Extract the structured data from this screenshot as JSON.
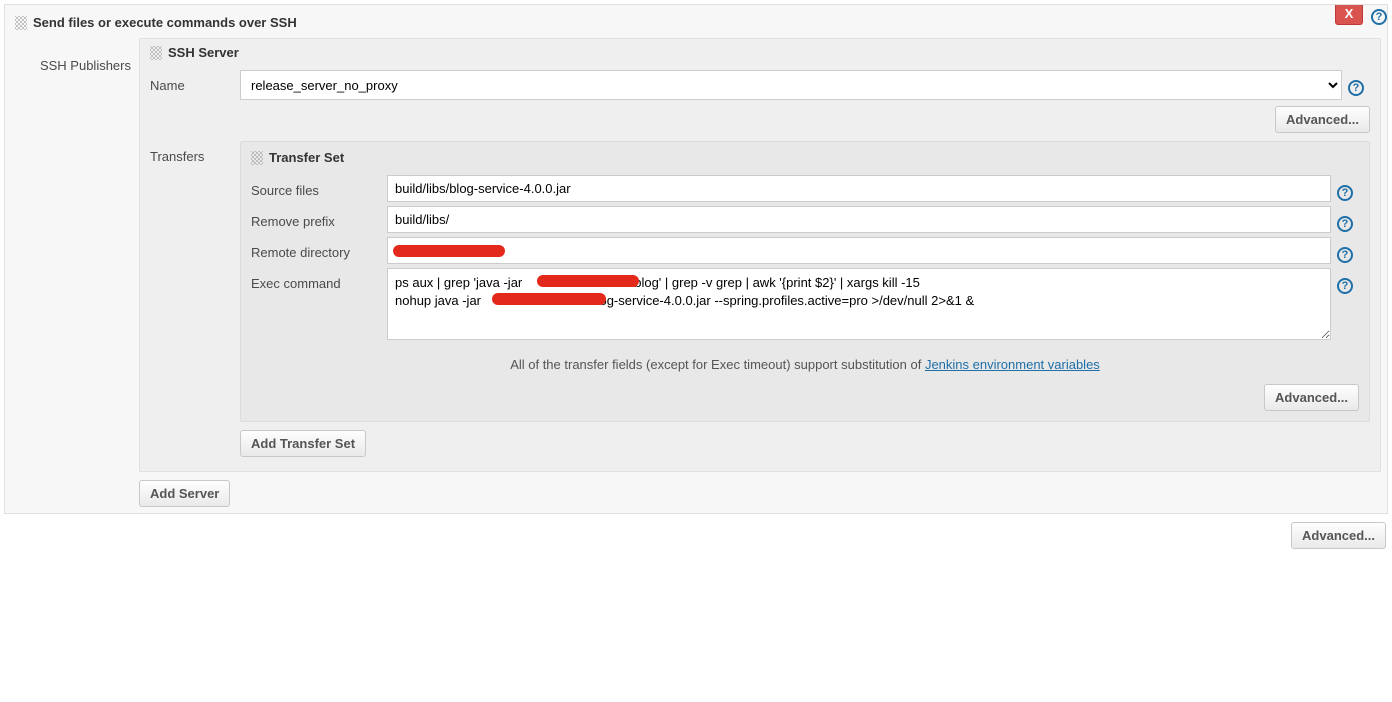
{
  "header": {
    "title": "Send files or execute commands over SSH",
    "close_label": "X"
  },
  "main": {
    "left_label": "SSH Publishers",
    "ssh_server": {
      "panel_title": "SSH Server",
      "name_label": "Name",
      "name_value": "release_server_no_proxy",
      "advanced_label": "Advanced..."
    },
    "transfers": {
      "label": "Transfers",
      "set_title": "Transfer Set",
      "source_label": "Source files",
      "source_value": "build/libs/blog-service-4.0.0.jar",
      "remove_prefix_label": "Remove prefix",
      "remove_prefix_value": "build/libs/",
      "remote_dir_label": "Remote directory",
      "remote_dir_value": "",
      "exec_label": "Exec command",
      "exec_value": "ps aux | grep 'java -jar                              /blog' | grep -v grep | awk '{print $2}' | xargs kill -15\nnohup java -jar                             /blog-service-4.0.0.jar --spring.profiles.active=pro >/dev/null 2>&1 &",
      "hint_prefix": "All of the transfer fields (except for Exec timeout) support substitution of ",
      "hint_link": "Jenkins environment variables",
      "advanced_label": "Advanced...",
      "add_transfer_label": "Add Transfer Set"
    },
    "add_server_label": "Add Server",
    "outer_advanced_label": "Advanced..."
  }
}
